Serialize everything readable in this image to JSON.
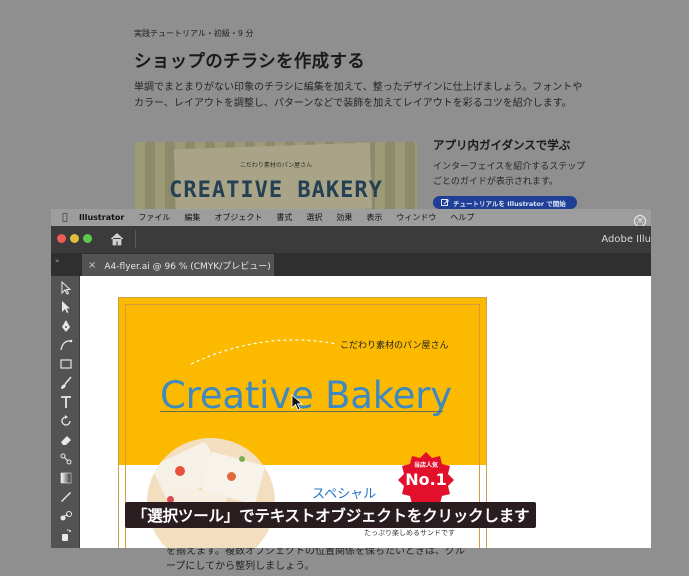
{
  "tutorial": {
    "meta": "実践チュートリアル・初級・9 分",
    "title": "ショップのチラシを作成する",
    "intro": "単調でまとまりがない印象のチラシに編集を加えて、整ったデザインに仕上げましょう。フォントやカラー、レイアウトを調整し、パターンなどで装飾を加えてレイアウトを彩るコツを紹介します。",
    "banner_small": "こだわり素材のパン屋さん",
    "banner_big": "CREATIVE BAKERY",
    "outro": "を揃えます。複数オブジェクトの位置関係を保ちたいときは、グループにしてから整列しましょう。"
  },
  "guidance": {
    "heading": "アプリ内ガイダンスで学ぶ",
    "text": "インターフェイスを紹介するステップごとのガイドが表示されます。",
    "button_label": "チュートリアルを Illustrator で開始"
  },
  "menubar": {
    "app": "Illustrator",
    "items": [
      "ファイル",
      "編集",
      "オブジェクト",
      "書式",
      "選択",
      "効果",
      "表示",
      "ウィンドウ",
      "ヘルプ"
    ]
  },
  "window": {
    "app_title": "Adobe Illu",
    "doc_tab": "A4-flyer.ai @ 96 % (CMYK/プレビュー)",
    "panel_chevron": "»",
    "traffic": {
      "close": "#ec5f56",
      "min": "#e0bd3e",
      "max": "#5ec84e"
    }
  },
  "flyer": {
    "tagline": "こだわり素材のパン屋さん",
    "logo": "Creative Bakery",
    "special": "スペシャル",
    "subcopy": "たっぷり楽しめるサンドです",
    "seal_top": "当店人気",
    "seal_num": "No.1",
    "colors": {
      "background": "#fbba00",
      "logo": "#3e89c0",
      "seal": "#e2102a"
    }
  },
  "caption": "「選択ツール」でテキストオブジェクトをクリックします"
}
